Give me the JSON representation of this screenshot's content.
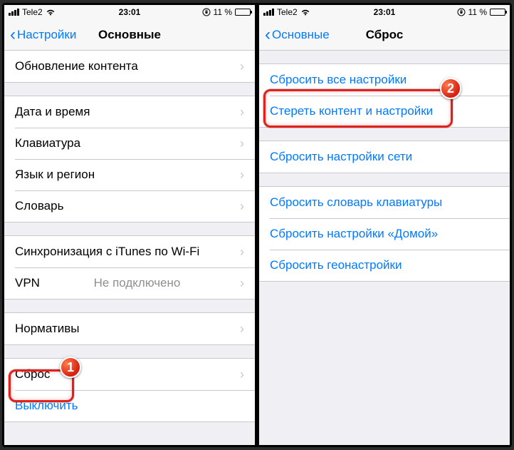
{
  "status": {
    "carrier": "Tele2",
    "time": "23:01",
    "battery_text": "11 %"
  },
  "left": {
    "back_label": "Настройки",
    "title": "Основные",
    "rows": {
      "content_update": "Обновление контента",
      "date_time": "Дата и время",
      "keyboard": "Клавиатура",
      "language_region": "Язык и регион",
      "dictionary": "Словарь",
      "itunes_wifi": "Синхронизация с iTunes по Wi-Fi",
      "vpn": "VPN",
      "vpn_status": "Не подключено",
      "regulatory": "Нормативы",
      "reset": "Сброс",
      "shutdown": "Выключить"
    },
    "badge": "1"
  },
  "right": {
    "back_label": "Основные",
    "title": "Сброс",
    "rows": {
      "reset_all": "Сбросить все настройки",
      "erase_all": "Стереть контент и настройки",
      "reset_network": "Сбросить настройки сети",
      "reset_keyboard": "Сбросить словарь клавиатуры",
      "reset_home": "Сбросить настройки «Домой»",
      "reset_location": "Сбросить геонастройки"
    },
    "badge": "2"
  }
}
